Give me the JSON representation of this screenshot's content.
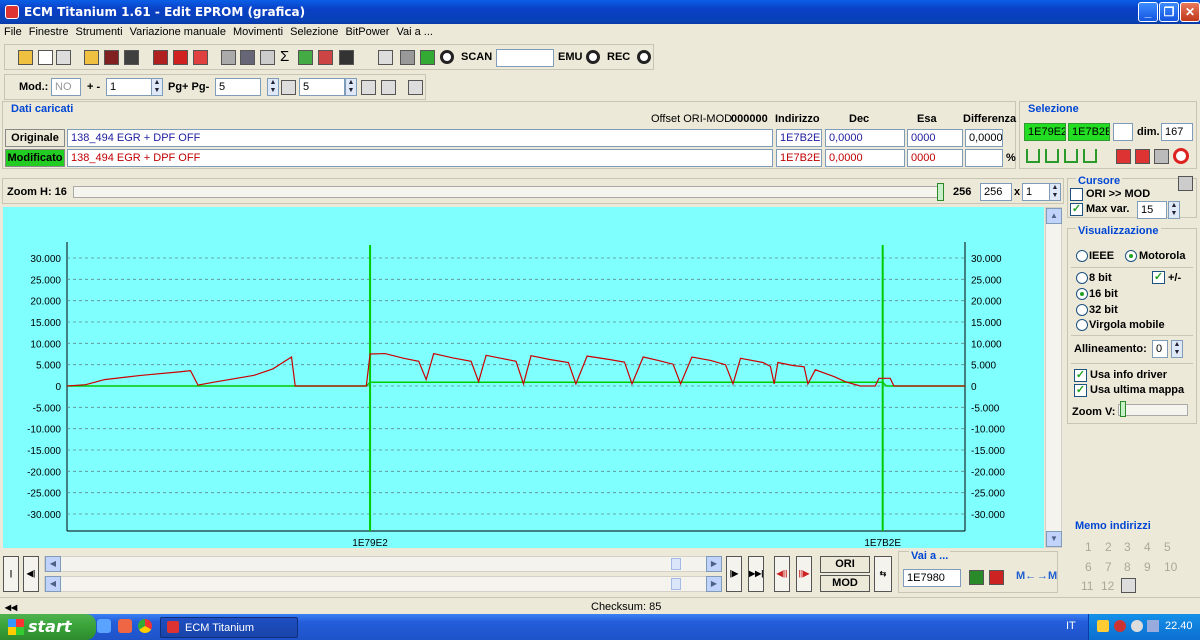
{
  "window": {
    "title": "ECM Titanium 1.61 - Edit EPROM (grafica)"
  },
  "menu": [
    "File",
    "Finestre",
    "Strumenti",
    "Variazione manuale",
    "Movimenti",
    "Selezione",
    "BitPower",
    "Vai a ..."
  ],
  "toolbar": {
    "scan_label": "SCAN",
    "emu_label": "EMU",
    "rec_label": "REC",
    "scan_value": ""
  },
  "toolbar2": {
    "mod_label": "Mod.:",
    "mod_value": "NO",
    "plusminus_label": "+ -",
    "plusminus_value": "1",
    "pg_label": "Pg+ Pg-",
    "pg_value": "5",
    "p_value": "5"
  },
  "dati": {
    "title": "Dati caricati",
    "offset_label": "Offset ORI-MOD",
    "offset_value": "000000",
    "col_indirizzo": "Indirizzo",
    "col_dec": "Dec",
    "col_esa": "Esa",
    "col_diff": "Differenza",
    "originale_label": "Originale",
    "modificato_label": "Modificato",
    "ori_name": "138_494 EGR + DPF OFF",
    "mod_name": "138_494 EGR + DPF OFF",
    "ori_addr": "1E7B2E",
    "mod_addr": "1E7B2E",
    "ori_dec": "0,0000",
    "mod_dec": "0,0000",
    "ori_esa": "0000",
    "mod_esa": "0000",
    "ori_diff": "0,0000",
    "mod_diff": "",
    "percent": "%"
  },
  "selezione": {
    "title": "Selezione",
    "start": "1E79E2",
    "end": "1E7B2E",
    "dim_label": "dim.",
    "dim_value": "167"
  },
  "zoom": {
    "label": "Zoom H: 16",
    "value_a": "256",
    "value_b": "256",
    "x": "x",
    "mult": "1"
  },
  "cursore": {
    "title": "Cursore",
    "ori_mod": "ORI >> MOD",
    "max_var": "Max var.",
    "max_var_value": "15"
  },
  "visualizzazione": {
    "title": "Visualizzazione",
    "ieee": "IEEE",
    "motorola": "Motorola",
    "b8": "8 bit",
    "pm": "+/-",
    "b16": "16 bit",
    "b32": "32 bit",
    "virgola": "Virgola mobile",
    "allineamento": "Allineamento:",
    "allineamento_value": "0",
    "info_driver": "Usa info driver",
    "ultima_mappa": "Usa ultima mappa",
    "zoom_v": "Zoom V:"
  },
  "memo": {
    "title": "Memo indirizzi",
    "numbers": [
      "1",
      "2",
      "3",
      "4",
      "5",
      "6",
      "7",
      "8",
      "9",
      "10",
      "11",
      "12"
    ]
  },
  "nav": {
    "vai_a_label": "Vai a ...",
    "vai_a_value": "1E7980",
    "ori_btn": "ORI",
    "mod_btn": "MOD"
  },
  "status": {
    "checksum": "Checksum: 85"
  },
  "taskbar": {
    "start": "start",
    "app": "ECM Titanium",
    "lang": "IT",
    "time": "22.40"
  },
  "colors": {
    "plot_bg": "#80ffff",
    "modified_line": "#cc0000",
    "original_line": "#00cc00",
    "marker": "#00cc00",
    "accent": "#0046d5"
  },
  "chart_data": {
    "type": "line",
    "ylim": [
      -32000,
      32000
    ],
    "yticks": [
      30000,
      25000,
      20000,
      15000,
      10000,
      5000,
      0,
      -5000,
      -10000,
      -15000,
      -20000,
      -25000,
      -30000
    ],
    "ytick_labels_left": [
      "30.000",
      "25.000",
      "20.000",
      "15.000",
      "10.000",
      "5.000",
      "0",
      "-5.000",
      "-10.000",
      "-15.000",
      "-20.000",
      "-25.000",
      "-30.000"
    ],
    "ytick_labels_right": [
      "30.000",
      "25.000",
      "20.000",
      "15.000",
      "10.000",
      "5.000",
      "0",
      "-5.000",
      "-10.000",
      "-15.000",
      "-20.000",
      "-25.000",
      "-30.000"
    ],
    "markers": [
      "1E79E2",
      "1E7B2E"
    ],
    "grid": true,
    "series": [
      {
        "points": [
          [
            0,
            0
          ],
          [
            5,
            300
          ],
          [
            10,
            1500
          ],
          [
            20,
            2500
          ],
          [
            30,
            3300
          ],
          [
            33,
            3600
          ],
          [
            35,
            200
          ],
          [
            40,
            1000
          ],
          [
            50,
            2500
          ],
          [
            55,
            4000
          ],
          [
            60,
            6800
          ],
          [
            61,
            0
          ],
          [
            80,
            0
          ],
          [
            81,
            7500
          ],
          [
            85,
            7600
          ],
          [
            90,
            6500
          ],
          [
            94,
            5800
          ],
          [
            96,
            1500
          ],
          [
            98,
            7600
          ],
          [
            103,
            6600
          ],
          [
            108,
            5800
          ],
          [
            110,
            1000
          ],
          [
            112,
            7200
          ],
          [
            116,
            6500
          ],
          [
            120,
            5800
          ],
          [
            122,
            500
          ],
          [
            124,
            7100
          ],
          [
            129,
            6200
          ],
          [
            134,
            5500
          ],
          [
            136,
            500
          ],
          [
            139,
            7000
          ],
          [
            145,
            6200
          ],
          [
            149,
            5600
          ],
          [
            151,
            500
          ],
          [
            154,
            6800
          ],
          [
            158,
            6000
          ],
          [
            162,
            5100
          ],
          [
            164,
            500
          ],
          [
            167,
            6800
          ],
          [
            172,
            6000
          ],
          [
            176,
            5000
          ],
          [
            178,
            500
          ],
          [
            180,
            6500
          ],
          [
            186,
            5500
          ],
          [
            188,
            4600
          ],
          [
            189,
            500
          ],
          [
            190,
            5500
          ],
          [
            194,
            4800
          ],
          [
            197,
            4500
          ],
          [
            198,
            500
          ],
          [
            200,
            3800
          ],
          [
            205,
            2200
          ],
          [
            208,
            1000
          ],
          [
            212,
            0
          ],
          [
            216,
            0
          ],
          [
            217,
            1800
          ],
          [
            220,
            1800
          ],
          [
            221,
            0
          ],
          [
            240,
            0
          ]
        ]
      },
      {
        "points": [
          [
            0,
            0
          ],
          [
            80,
            0
          ],
          [
            81,
            900
          ],
          [
            218,
            900
          ],
          [
            219,
            0
          ],
          [
            240,
            0
          ]
        ]
      }
    ]
  }
}
